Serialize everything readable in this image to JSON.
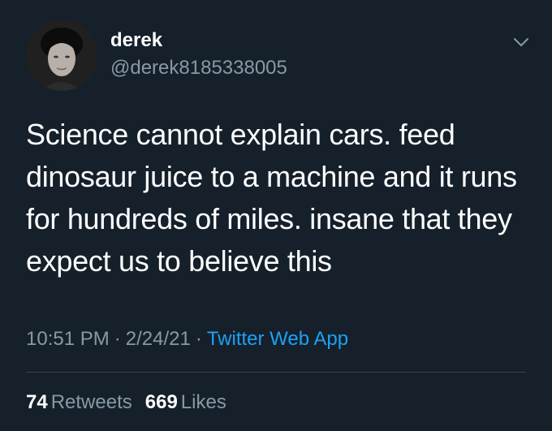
{
  "author": {
    "display_name": "derek",
    "handle": "@derek8185338005",
    "avatar_icon": "user-avatar"
  },
  "tweet": {
    "text": "Science cannot explain cars. feed dinosaur juice to a machine and it runs for hundreds of miles. insane that they expect us to believe this",
    "time": "10:51 PM",
    "date": "2/24/21",
    "source": "Twitter Web App",
    "separator": "·"
  },
  "stats": {
    "retweets_count": "74",
    "retweets_label": "Retweets",
    "likes_count": "669",
    "likes_label": "Likes"
  },
  "colors": {
    "background": "#15202b",
    "text": "#ffffff",
    "secondary": "#8899a6",
    "link": "#1da1f2",
    "divider": "#38444d"
  },
  "icons": {
    "menu": "chevron-down-icon"
  }
}
